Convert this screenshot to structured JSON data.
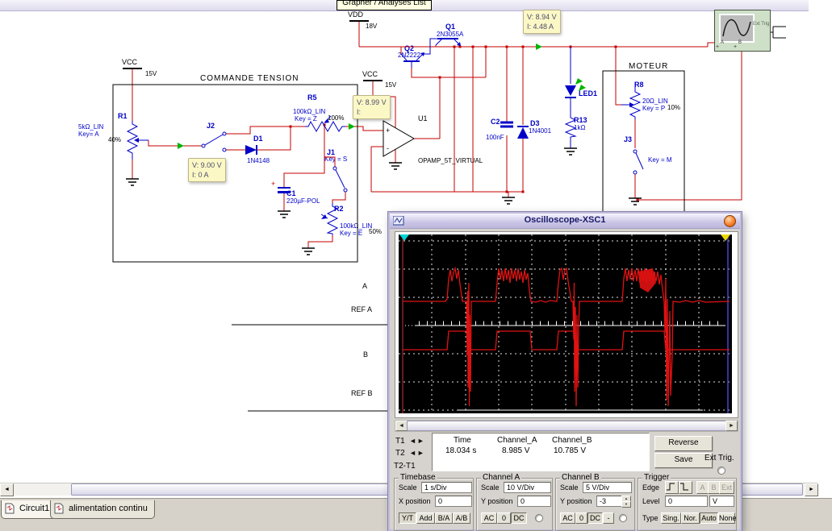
{
  "tooltip": "Grapher / Analyses List",
  "icons": {
    "scroll_left": "◄",
    "scroll_right": "►",
    "spin_up": "▲",
    "spin_down": "▼",
    "t_left": "◄",
    "t_right": "►"
  },
  "schematic": {
    "power": [
      {
        "name": "VDD",
        "value": "18V"
      },
      {
        "name": "VCC",
        "value": "15V"
      },
      {
        "name": "VCC",
        "value": "15V"
      }
    ],
    "section_boxes": [
      "COMMANDE TENSION",
      "MOTEUR"
    ],
    "components": {
      "r1": {
        "ref": "R1",
        "value": "5kΩ_LIN",
        "key": "Key= A",
        "pct": "40%"
      },
      "j2": {
        "ref": "J2"
      },
      "d1": {
        "ref": "D1",
        "value": "1N4148"
      },
      "r5": {
        "ref": "R5",
        "value": "100kΩ_LIN",
        "key": "Key = Z",
        "pct": "100%"
      },
      "j1": {
        "ref": "J1",
        "key": "Key = S"
      },
      "c1": {
        "ref": "C1",
        "value": "220µF-POL",
        "plus": "+"
      },
      "r2": {
        "ref": "R2",
        "value": "100kΩ_LIN",
        "key": "Key = E",
        "pct": "50%"
      },
      "u1": {
        "ref": "U1",
        "value": "OPAMP_5T_VIRTUAL",
        "plus": "+",
        "minus": "-"
      },
      "q2": {
        "ref": "Q2",
        "value": "2N2222"
      },
      "q1": {
        "ref": "Q1",
        "value": "2N3055A"
      },
      "c2": {
        "ref": "C2",
        "value": "100nF"
      },
      "d3": {
        "ref": "D3",
        "value": "1N4001"
      },
      "led1": {
        "ref": "LED1"
      },
      "r13": {
        "ref": "R13",
        "value": "1kΩ"
      },
      "r8": {
        "ref": "R8",
        "value": "20Ω_LIN",
        "key": "Key = P",
        "pct": "10%"
      },
      "j3": {
        "ref": "J3",
        "key": "Key = M"
      }
    },
    "probes": [
      {
        "v": "V: 9.00 V",
        "i": "I: 0 A"
      },
      {
        "v": "V: 8.99 V",
        "i": "I:"
      },
      {
        "v": "V: 8.94 V",
        "i": "I: 4.48 A"
      }
    ],
    "net_labels": [
      "A",
      "REF A",
      "B",
      "REF B"
    ],
    "instrument": {
      "ext_trig": "Ext Trig",
      "term_a": "A",
      "term_b": "B",
      "plus_a": "+",
      "plus_b": "+"
    }
  },
  "oscilloscope": {
    "title": "Oscilloscope-XSC1",
    "readout": {
      "t1": "T1",
      "t2": "T2",
      "t2_t1": "T2-T1",
      "col_time": "Time",
      "col_a": "Channel_A",
      "col_b": "Channel_B",
      "time": "18.034 s",
      "va": "8.985 V",
      "vb": "10.785 V",
      "reverse": "Reverse",
      "save": "Save",
      "ext": "Ext Trig."
    },
    "timebase": {
      "legend": "Timebase",
      "scale_label": "Scale",
      "scale": "1 s/Div",
      "pos_label": "X position",
      "pos": "0",
      "buttons": [
        "Y/T",
        "Add",
        "B/A",
        "A/B"
      ]
    },
    "channel_a": {
      "legend": "Channel A",
      "scale_label": "Scale",
      "scale": "10 V/Div",
      "pos_label": "Y position",
      "pos": "0",
      "buttons": [
        "AC",
        "0",
        "DC"
      ]
    },
    "channel_b": {
      "legend": "Channel B",
      "scale_label": "Scale",
      "scale": "5 V/Div",
      "pos_label": "Y position",
      "pos": "-3",
      "buttons": [
        "AC",
        "0",
        "DC",
        "-"
      ]
    },
    "trigger": {
      "legend": "Trigger",
      "edge_label": "Edge",
      "sel": [
        "A",
        "B",
        "Ext"
      ],
      "level_label": "Level",
      "level": "0",
      "unit": "V",
      "type_label": "Type",
      "types": [
        "Sing.",
        "Nor.",
        "Auto",
        "None"
      ]
    }
  },
  "workspace_tabs": [
    {
      "label": "Circuit1"
    },
    {
      "label": "alimentation continu"
    }
  ]
}
